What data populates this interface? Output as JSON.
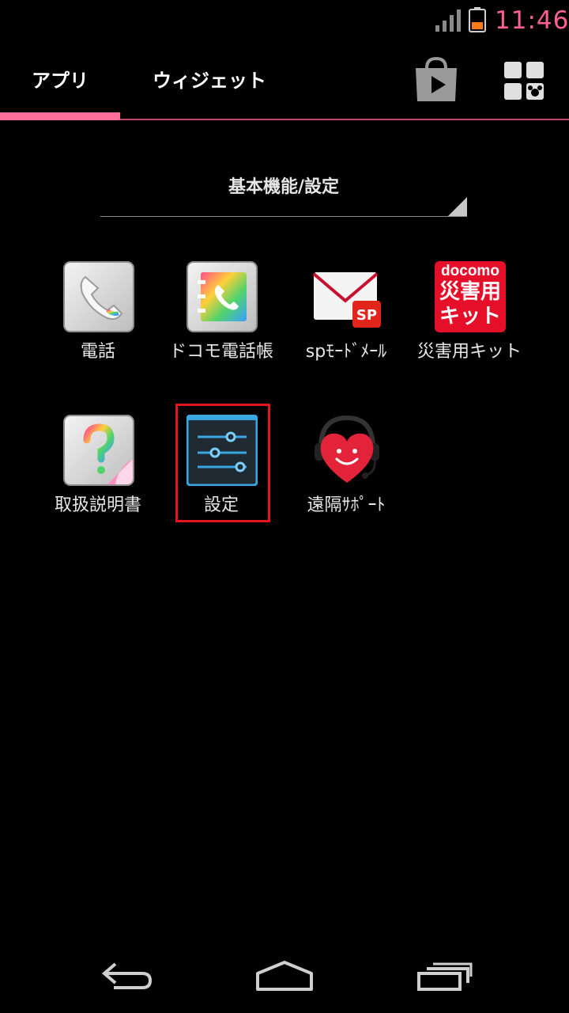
{
  "status_bar": {
    "time": "11:46",
    "signal_icon": "signal-icon",
    "battery_icon": "battery-icon",
    "accent": "#ff5f93"
  },
  "tabs": [
    {
      "label": "アプリ",
      "selected": true
    },
    {
      "label": "ウィジェット",
      "selected": false
    }
  ],
  "header_icons": {
    "store": "play-store-icon",
    "menu": "app-grid-menu-icon"
  },
  "category": {
    "label": "基本機能/設定"
  },
  "apps": [
    {
      "label": "電話",
      "icon": "phone-icon"
    },
    {
      "label": "ドコモ電話帳",
      "icon": "phonebook-icon"
    },
    {
      "label": "spﾓｰﾄﾞﾒｰﾙ",
      "icon": "sp-mode-mail-icon"
    },
    {
      "label": "災害用キット",
      "icon": "disaster-kit-icon",
      "icon_brand": "docomo",
      "icon_text": "災害用キット"
    },
    {
      "label": "取扱説明書",
      "icon": "manual-icon"
    },
    {
      "label": "設定",
      "icon": "settings-icon",
      "highlighted": true
    },
    {
      "label": "遠隔ｻﾎﾟｰﾄ",
      "icon": "remote-support-icon"
    }
  ],
  "nav": {
    "back": "back-icon",
    "home": "home-icon",
    "recents": "recents-icon"
  },
  "colors": {
    "tab_indicator": "#ff6f9c",
    "highlight_box": "#e3161b"
  }
}
